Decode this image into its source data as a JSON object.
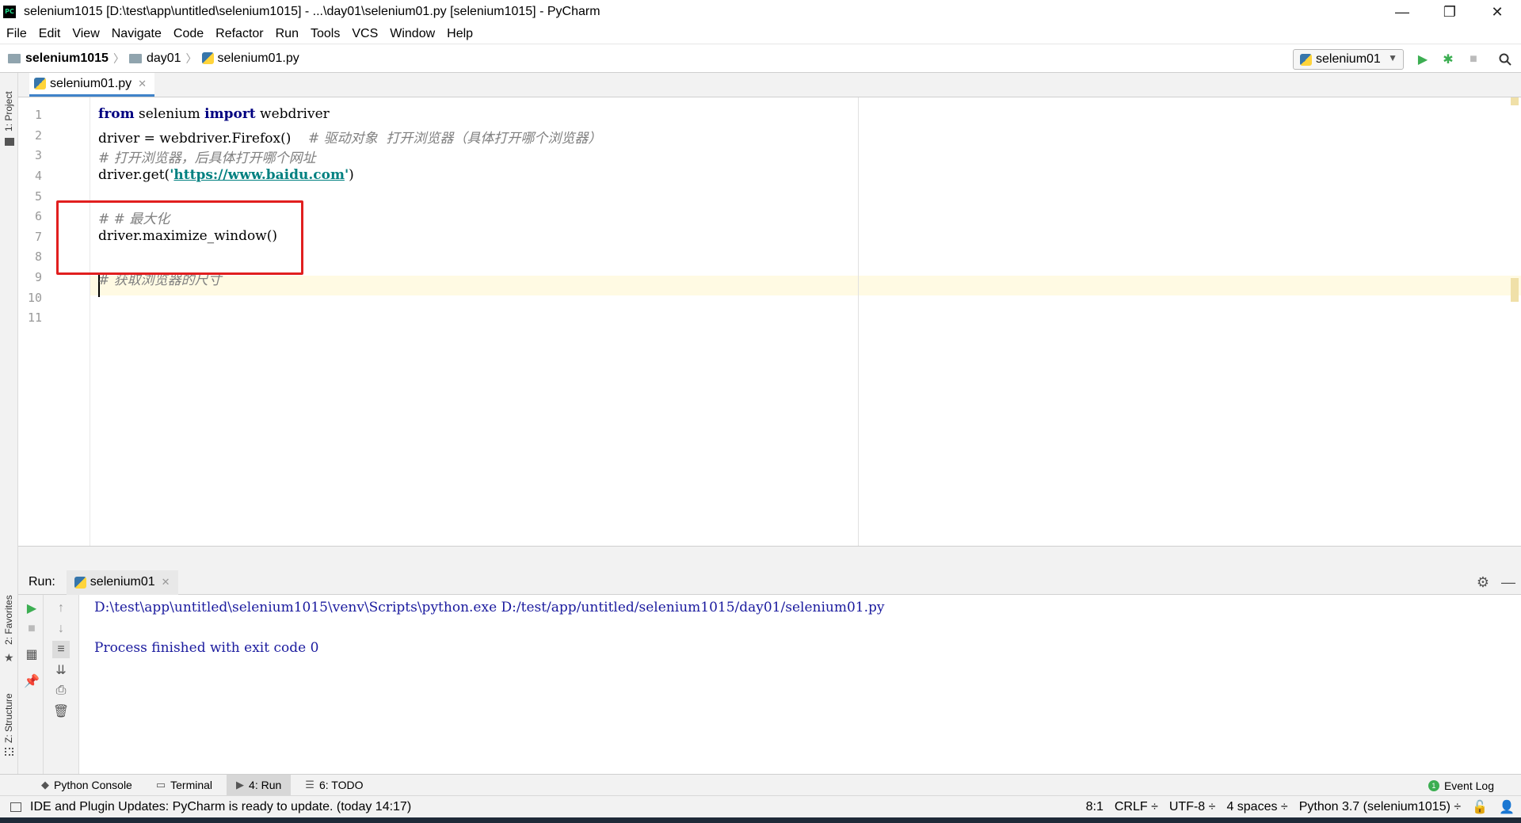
{
  "window": {
    "title": "selenium1015 [D:\\test\\app\\untitled\\selenium1015] - ...\\day01\\selenium01.py [selenium1015] - PyCharm",
    "app_icon_text": "PC",
    "controls": {
      "minimize": "—",
      "restore": "❐",
      "close": "✕"
    }
  },
  "menu": [
    "File",
    "Edit",
    "View",
    "Navigate",
    "Code",
    "Refactor",
    "Run",
    "Tools",
    "VCS",
    "Window",
    "Help"
  ],
  "breadcrumb": {
    "project": "selenium1015",
    "folder": "day01",
    "file": "selenium01.py"
  },
  "toolbar": {
    "run_config": "selenium01",
    "run_icon": "play-icon",
    "debug_icon": "bug-icon",
    "stop_icon": "stop-icon",
    "search_icon": "search-icon"
  },
  "side_tabs": {
    "project": "1: Project",
    "favorites": "2: Favorites",
    "structure": "Z: Structure"
  },
  "editor": {
    "tab_label": "selenium01.py",
    "line_numbers": [
      "1",
      "2",
      "3",
      "4",
      "5",
      "6",
      "7",
      "8",
      "9",
      "10",
      "11"
    ],
    "lines": {
      "l1": {
        "kw1": "from",
        "mod": " selenium ",
        "kw2": "import",
        "name": " webdriver"
      },
      "l2": {
        "code": "driver = webdriver.Firefox()",
        "comment": "    # 驱动对象  打开浏览器（具体打开哪个浏览器）"
      },
      "l3": {
        "comment": "# 打开浏览器，后具体打开哪个网址"
      },
      "l4": {
        "prefix": "driver.get(",
        "q1": "'",
        "url": "https://www.baidu.com",
        "q2": "'",
        "suffix": ")"
      },
      "l6": {
        "comment": "# # 最大化"
      },
      "l7": {
        "code": "driver.maximize_window()"
      },
      "l9": {
        "comment": "# 获取浏览器的尺寸"
      }
    },
    "current_line": 8
  },
  "run_panel": {
    "label": "Run:",
    "tab": "selenium01",
    "console": [
      "D:\\test\\app\\untitled\\selenium1015\\venv\\Scripts\\python.exe D:/test/app/untitled/selenium1015/day01/selenium01.py",
      "",
      "Process finished with exit code 0"
    ]
  },
  "bottom_tabs": [
    {
      "icon": "python-console-icon",
      "label": "Python Console"
    },
    {
      "icon": "terminal-icon",
      "label": "Terminal"
    },
    {
      "icon": "run-icon",
      "label": "4: Run"
    },
    {
      "icon": "todo-icon",
      "label": "6: TODO"
    }
  ],
  "event_log": {
    "label": "Event Log",
    "count": "1"
  },
  "status": {
    "message": "IDE and Plugin Updates: PyCharm is ready to update. (today 14:17)",
    "position": "8:1",
    "line_sep": "CRLF ÷",
    "encoding": "UTF-8 ÷",
    "indent": "4 spaces ÷",
    "interpreter": "Python 3.7 (selenium1015) ÷"
  },
  "colors": {
    "keyword": "#000080",
    "comment": "#808080",
    "string": "#008080",
    "console_text": "#1a1a9e",
    "annotation_box": "#e11f1f",
    "current_line": "#fffae3"
  }
}
